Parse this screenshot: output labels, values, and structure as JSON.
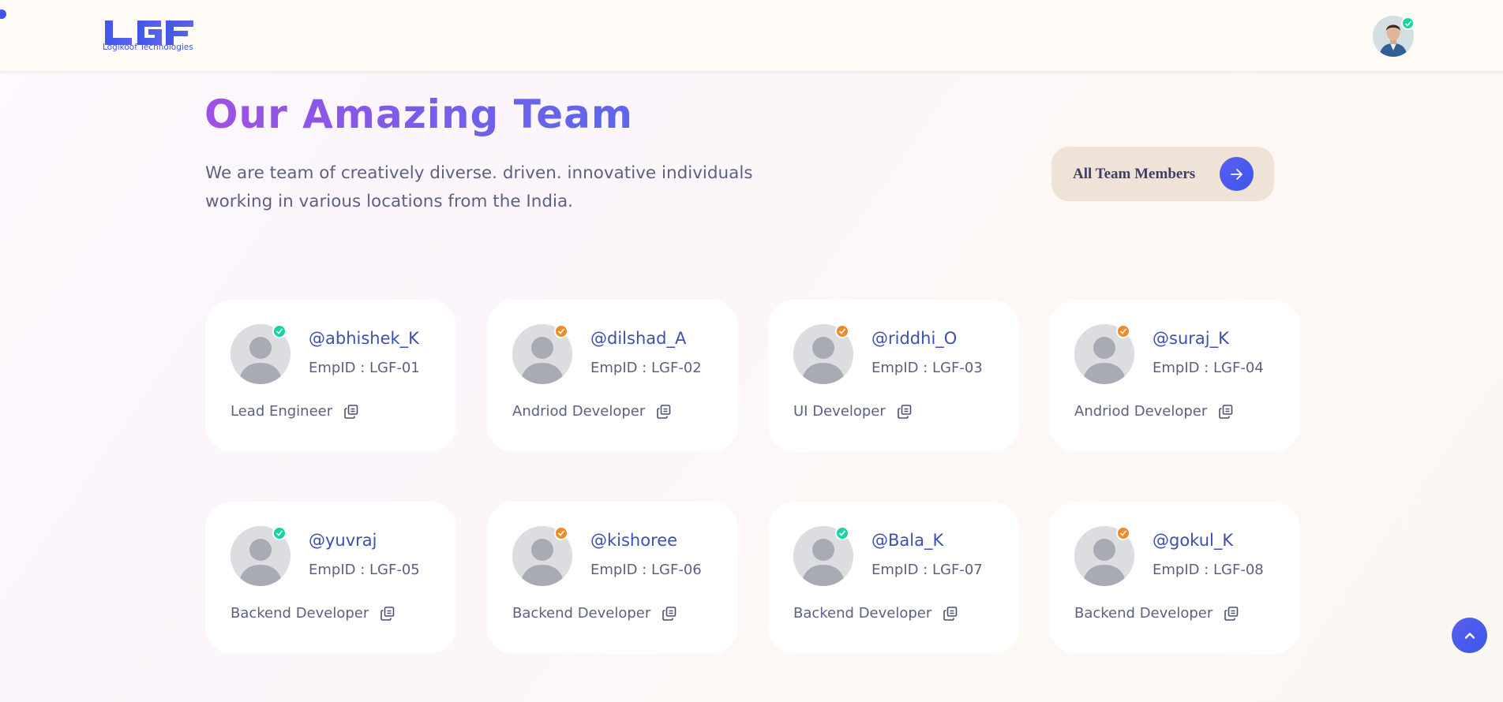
{
  "brand": {
    "logo_letters": "LGF",
    "name": "Logikoof Technologies"
  },
  "header": {
    "profile_avatar": "user-avatar-photo",
    "profile_status": "online"
  },
  "hero": {
    "title": "Our Amazing Team",
    "subtitle": "We are team of creatively diverse. driven. innovative individuals working in various locations from the India.",
    "cta_label": "All Team Members"
  },
  "colors": {
    "accent": "#3b55e6",
    "title_gradient": [
      "#a14fe6",
      "#5e67e8"
    ],
    "status_online": "#16d3a5",
    "status_away": "#f28a2a",
    "cta_bg": "#efe3d8"
  },
  "team": [
    {
      "username": "@abhishek_K",
      "empid": "EmpID : LGF-01",
      "role": "Lead Engineer",
      "status": "green"
    },
    {
      "username": "@dilshad_A",
      "empid": "EmpID : LGF-02",
      "role": "Andriod Developer",
      "status": "orange"
    },
    {
      "username": "@riddhi_O",
      "empid": "EmpID : LGF-03",
      "role": "UI Developer",
      "status": "orange"
    },
    {
      "username": "@suraj_K",
      "empid": "EmpID : LGF-04",
      "role": "Andriod Developer",
      "status": "orange"
    },
    {
      "username": "@yuvraj",
      "empid": "EmpID : LGF-05",
      "role": "Backend Developer",
      "status": "green"
    },
    {
      "username": "@kishoree",
      "empid": "EmpID : LGF-06",
      "role": "Backend Developer",
      "status": "orange"
    },
    {
      "username": "@Bala_K",
      "empid": "EmpID : LGF-07",
      "role": "Backend Developer",
      "status": "green"
    },
    {
      "username": "@gokul_K",
      "empid": "EmpID : LGF-08",
      "role": "Backend Developer",
      "status": "orange"
    }
  ],
  "icons": {
    "copy": "copy-icon",
    "arrow": "arrow-right-icon",
    "scroll_top": "chevron-up-icon",
    "status": "check-icon"
  }
}
